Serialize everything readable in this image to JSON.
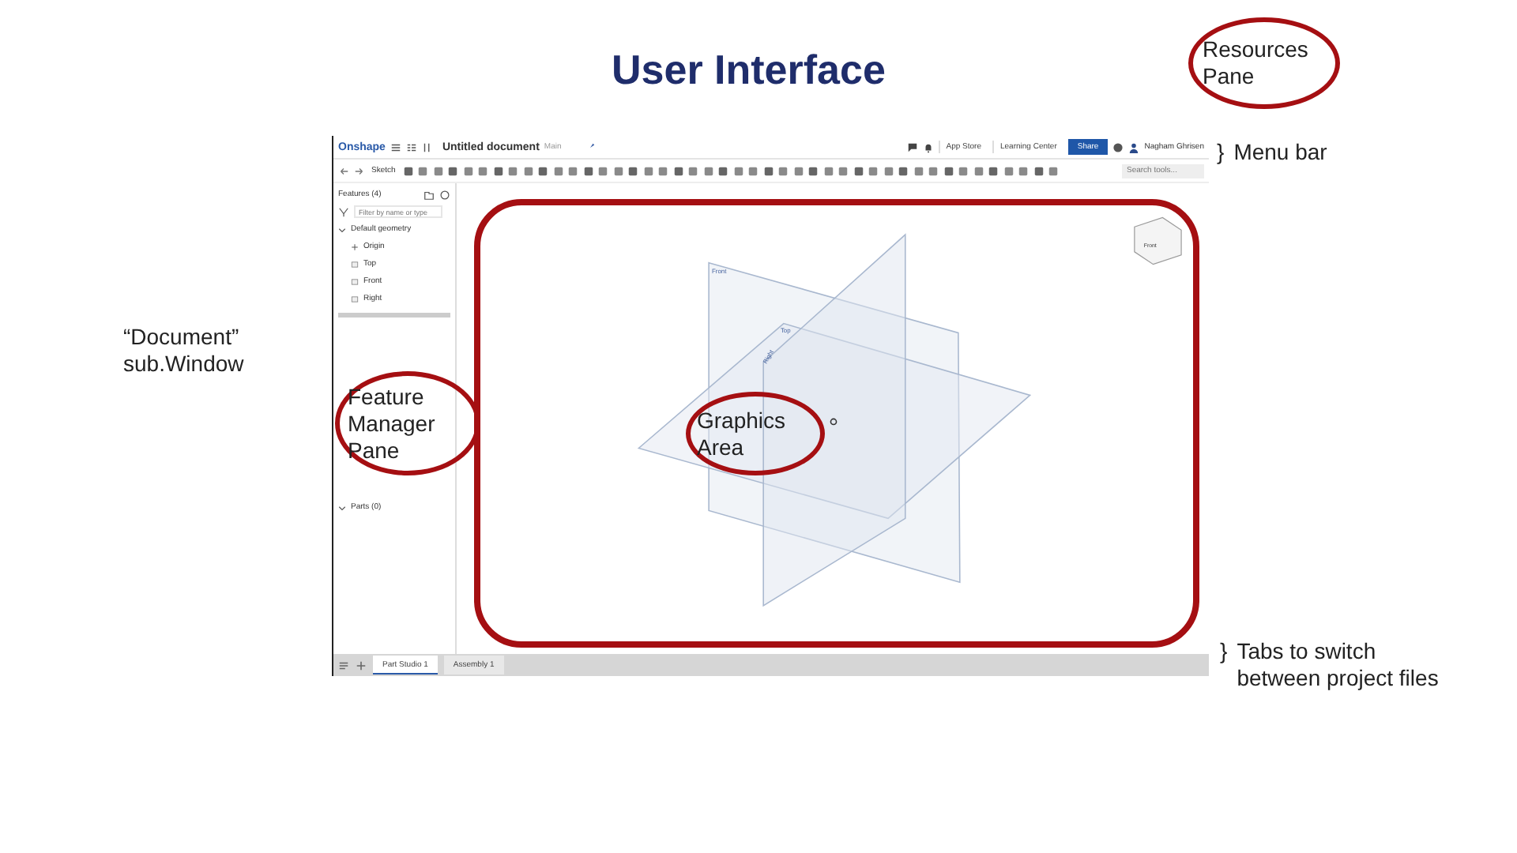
{
  "title": "User Interface",
  "resources_callout": {
    "lines": [
      "Resources",
      "Pane"
    ]
  },
  "menu_bar_callout": {
    "brace": "}",
    "text": "Menu bar"
  },
  "document_callout": {
    "lines": [
      "“Document”",
      "sub.Window"
    ]
  },
  "feature_callout": {
    "lines": [
      "Feature",
      "Manager",
      "Pane"
    ]
  },
  "graphics_callout": {
    "lines": [
      "Graphics",
      "Area"
    ]
  },
  "tabs_callout": {
    "brace": "}",
    "lines": [
      "Tabs to switch",
      "between project files"
    ]
  },
  "app": {
    "logo": "Onshape",
    "document_title": "Untitled document",
    "branch": "Main",
    "header_buttons": [
      "App Store",
      "Learning Center"
    ],
    "share_button": "Share",
    "user_name": "Nagham Ghrisen",
    "sketch_button": "Sketch",
    "search_placeholder": "Search tools...",
    "features_header": "Features (4)",
    "filter_placeholder": "Filter by name or type",
    "tree": [
      {
        "label": "Default geometry",
        "expanded": true,
        "children": [
          {
            "label": "Origin",
            "kind": "point"
          },
          {
            "label": "Top",
            "kind": "plane"
          },
          {
            "label": "Front",
            "kind": "plane"
          },
          {
            "label": "Right",
            "kind": "plane"
          }
        ]
      }
    ],
    "parts": {
      "label": "Parts (0)",
      "expanded": true
    },
    "plane_labels": [
      "Front",
      "Top",
      "Right"
    ],
    "view_cube_label": "Front",
    "tabs": [
      {
        "label": "Part Studio 1",
        "selected": true
      },
      {
        "label": "Assembly 1",
        "selected": false
      }
    ]
  }
}
